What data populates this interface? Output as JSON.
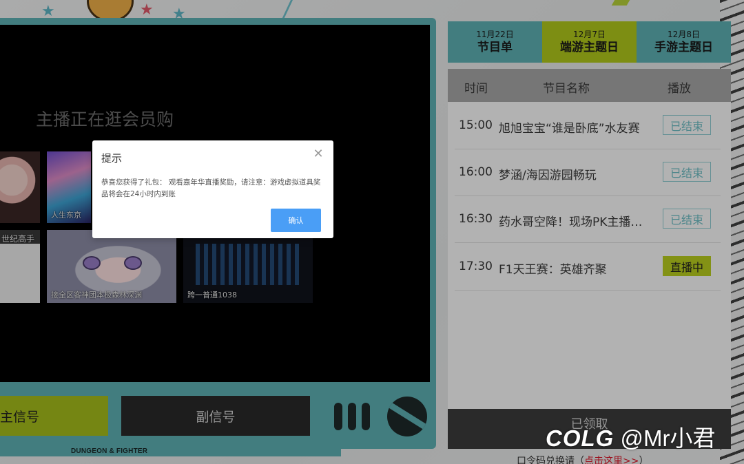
{
  "screen": {
    "title": "主播正在逛会员购",
    "thumbs": [
      {
        "caption": ""
      },
      {
        "caption": "人生东京"
      },
      {
        "caption": "世纪高手"
      },
      {
        "caption": "接全区客神团本极森林深渊"
      },
      {
        "caption": "跨一普通1038"
      }
    ]
  },
  "signals": {
    "main_label": "主信号",
    "sub_label": "副信号"
  },
  "brand": {
    "game_name": "DUNGEON & FIGHTER"
  },
  "tabs": [
    {
      "date": "11月22日",
      "name": "节目单",
      "active": false
    },
    {
      "date": "12月7日",
      "name": "端游主题日",
      "active": true
    },
    {
      "date": "12月8日",
      "name": "手游主题日",
      "active": false
    }
  ],
  "schedule": {
    "headers": {
      "time": "时间",
      "name": "节目名称",
      "play": "播放"
    },
    "rows": [
      {
        "time": "15:00",
        "title": "旭旭宝宝“谁是卧底”水友赛",
        "status": "已结束"
      },
      {
        "time": "16:00",
        "title": "梦涵/海因游园畅玩",
        "status": "已结束"
      },
      {
        "time": "16:30",
        "title": "药水哥空降！现场PK主播…",
        "status": "已结束"
      },
      {
        "time": "17:30",
        "title": "F1天王赛：英雄齐聚",
        "status": "直播中"
      }
    ],
    "claim_label": "已领取",
    "redeem_text": "口令码兑换请（",
    "redeem_link": "点击这里>>",
    "redeem_tail": "）"
  },
  "dialog": {
    "title": "提示",
    "close_icon": "close-icon",
    "body": "恭喜您获得了礼包： 观看嘉年华直播奖励，请注意：游戏虚拟道具奖品将会在24小时内到账",
    "ok_label": "确认"
  },
  "watermark": {
    "logo": "COLG",
    "handle": "@Mr小君"
  },
  "colors": {
    "teal": "#5fb4b7",
    "lime": "#b3cc1c",
    "dialog_button": "#4a9ef6",
    "link_red": "#e0182a"
  }
}
